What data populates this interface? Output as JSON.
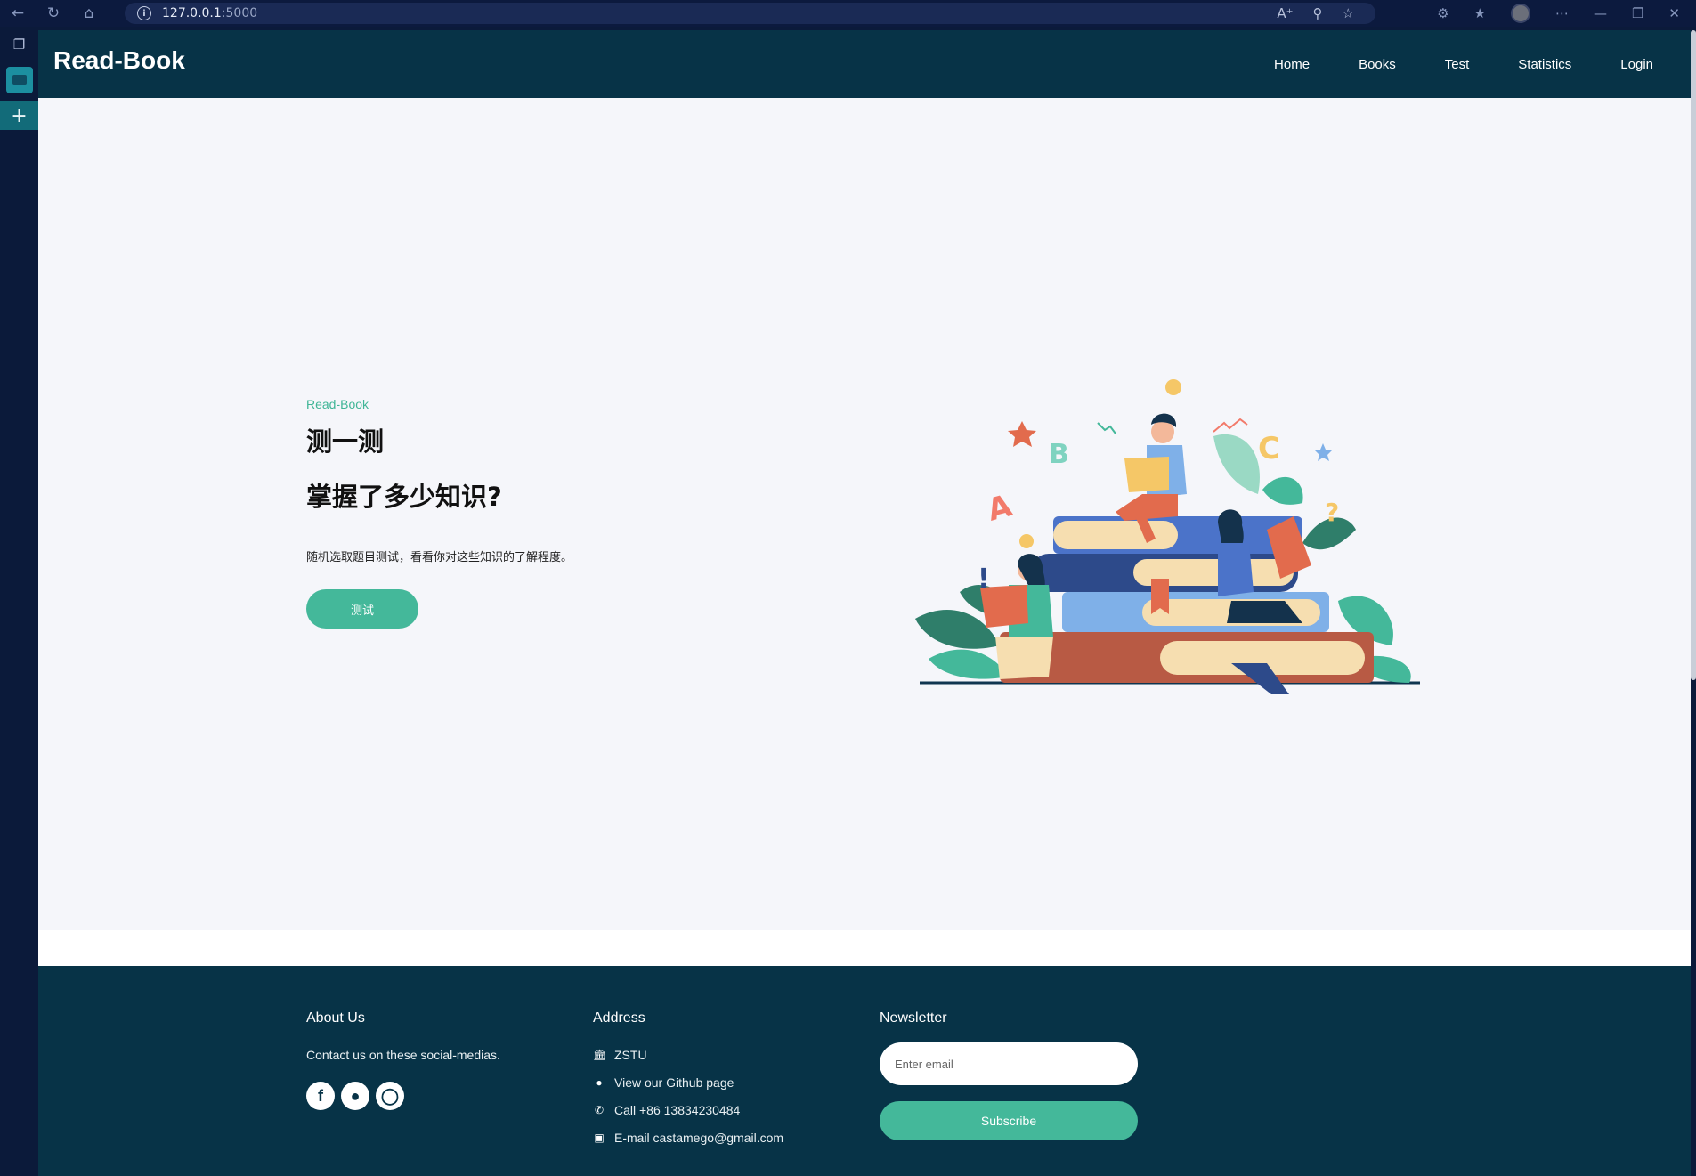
{
  "browser": {
    "url_host": "127.0.0.1",
    "url_port": ":5000"
  },
  "nav": {
    "brand": "Read-Book",
    "links": [
      "Home",
      "Books",
      "Test",
      "Statistics",
      "Login"
    ]
  },
  "hero": {
    "kicker": "Read-Book",
    "title_line1": "测一测",
    "title_line2": "掌握了多少知识?",
    "description": "随机选取题目测试，看看你对这些知识的了解程度。",
    "button_label": "测试"
  },
  "carousel": {
    "prev_icon": "chevron-left-icon",
    "next_icon": "chevron-right-icon"
  },
  "footer": {
    "about": {
      "heading": "About Us",
      "text": "Contact us on these social-medias.",
      "socials": [
        "facebook-icon",
        "qq-icon",
        "github-icon"
      ]
    },
    "address": {
      "heading": "Address",
      "items": [
        {
          "icon": "bank-icon",
          "text": "ZSTU"
        },
        {
          "icon": "github-icon",
          "text": "View our Github page"
        },
        {
          "icon": "phone-icon",
          "text": "Call +86 13834230484"
        },
        {
          "icon": "contact-card-icon",
          "text": "E-mail castamego@gmail.com"
        }
      ]
    },
    "newsletter": {
      "heading": "Newsletter",
      "placeholder": "Enter email",
      "button_label": "Subscribe"
    }
  },
  "colors": {
    "nav_bg": "#073347",
    "accent": "#44b89a",
    "page_bg": "#f5f6fa"
  }
}
